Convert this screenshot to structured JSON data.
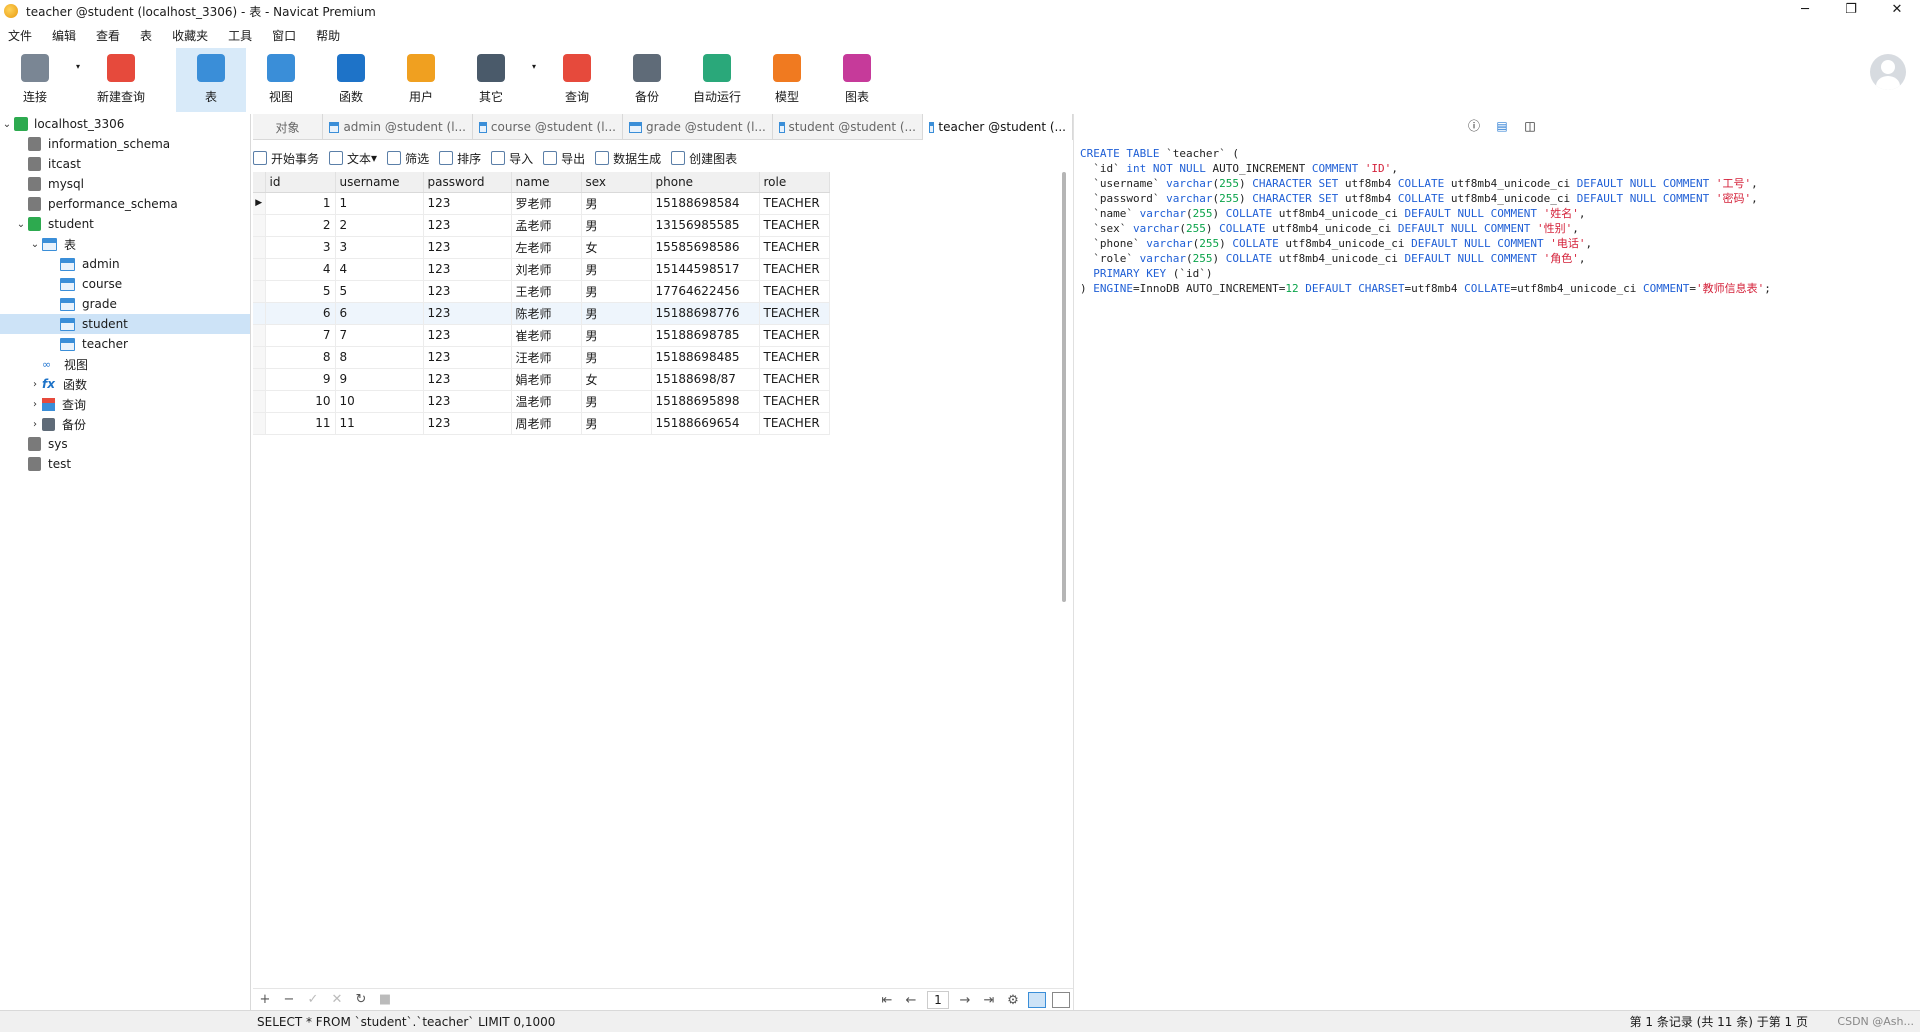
{
  "window": {
    "title": "teacher @student (localhost_3306) - 表 - Navicat Premium",
    "controls": [
      "─",
      "❐",
      "✕"
    ]
  },
  "menu": [
    "文件",
    "编辑",
    "查看",
    "表",
    "收藏夹",
    "工具",
    "窗口",
    "帮助"
  ],
  "toolbar": [
    {
      "label": "连接",
      "icon": "plug-icon",
      "color": "#7a8694",
      "caret": true
    },
    {
      "label": "新建查询",
      "icon": "new-query-icon",
      "color": "#e64a3c",
      "caret": false
    },
    {
      "label": "表",
      "icon": "table-icon",
      "color": "#3a8ed8",
      "caret": false,
      "active": true
    },
    {
      "label": "视图",
      "icon": "view-icon",
      "color": "#3a8ed8",
      "caret": false
    },
    {
      "label": "函数",
      "icon": "function-icon",
      "color": "#1e73c8",
      "caret": false
    },
    {
      "label": "用户",
      "icon": "user-icon",
      "color": "#f0a020",
      "caret": false
    },
    {
      "label": "其它",
      "icon": "tools-icon",
      "color": "#4a5a6a",
      "caret": true
    },
    {
      "label": "查询",
      "icon": "query-icon",
      "color": "#e64a3c",
      "caret": false
    },
    {
      "label": "备份",
      "icon": "backup-icon",
      "color": "#5f6b78",
      "caret": false
    },
    {
      "label": "自动运行",
      "icon": "robot-icon",
      "color": "#2aa87a",
      "caret": false
    },
    {
      "label": "模型",
      "icon": "model-icon",
      "color": "#f07a20",
      "caret": false
    },
    {
      "label": "图表",
      "icon": "chart-icon",
      "color": "#c63a9a",
      "caret": false
    }
  ],
  "tree": {
    "connection": "localhost_3306",
    "databases_top": [
      "information_schema",
      "itcast",
      "mysql",
      "performance_schema"
    ],
    "student": "student",
    "tables_label": "表",
    "tables": [
      "admin",
      "course",
      "grade",
      "student",
      "teacher"
    ],
    "views_label": "视图",
    "functions_label": "函数",
    "queries_label": "查询",
    "backups_label": "备份",
    "databases_bottom": [
      "sys",
      "test"
    ]
  },
  "tabs": [
    "对象",
    "admin @student (l...",
    "course @student (l...",
    "grade @student (l...",
    "student @student (...",
    "teacher @student (..."
  ],
  "gridbar": [
    "开始事务",
    "文本",
    "筛选",
    "排序",
    "导入",
    "导出",
    "数据生成",
    "创建图表"
  ],
  "table": {
    "columns": [
      "id",
      "username",
      "password",
      "name",
      "sex",
      "phone",
      "role"
    ],
    "rows": [
      [
        "1",
        "1",
        "123",
        "罗老师",
        "男",
        "15188698584",
        "TEACHER"
      ],
      [
        "2",
        "2",
        "123",
        "孟老师",
        "男",
        "13156985585",
        "TEACHER"
      ],
      [
        "3",
        "3",
        "123",
        "左老师",
        "女",
        "15585698586",
        "TEACHER"
      ],
      [
        "4",
        "4",
        "123",
        "刘老师",
        "男",
        "15144598517",
        "TEACHER"
      ],
      [
        "5",
        "5",
        "123",
        "王老师",
        "男",
        "17764622456",
        "TEACHER"
      ],
      [
        "6",
        "6",
        "123",
        "陈老师",
        "男",
        "15188698776",
        "TEACHER"
      ],
      [
        "7",
        "7",
        "123",
        "崔老师",
        "男",
        "15188698785",
        "TEACHER"
      ],
      [
        "8",
        "8",
        "123",
        "汪老师",
        "男",
        "15188698485",
        "TEACHER"
      ],
      [
        "9",
        "9",
        "123",
        "娟老师",
        "女",
        "15188698/87",
        "TEACHER"
      ],
      [
        "10",
        "10",
        "123",
        "温老师",
        "男",
        "15188695898",
        "TEACHER"
      ],
      [
        "11",
        "11",
        "123",
        "周老师",
        "男",
        "15188669654",
        "TEACHER"
      ]
    ]
  },
  "bottombar": {
    "buttons": [
      "+",
      "−",
      "✓",
      "✕",
      "↻",
      "■"
    ],
    "page": "1",
    "nav": [
      "⇤",
      "←",
      "→",
      "⇥",
      "⚙"
    ]
  },
  "ddl": [
    "CREATE TABLE `teacher` (",
    "  `id` int NOT NULL AUTO_INCREMENT COMMENT 'ID',",
    "  `username` varchar(255) CHARACTER SET utf8mb4 COLLATE utf8mb4_unicode_ci DEFAULT NULL COMMENT '工号',",
    "  `password` varchar(255) CHARACTER SET utf8mb4 COLLATE utf8mb4_unicode_ci DEFAULT NULL COMMENT '密码',",
    "  `name` varchar(255) COLLATE utf8mb4_unicode_ci DEFAULT NULL COMMENT '姓名',",
    "  `sex` varchar(255) COLLATE utf8mb4_unicode_ci DEFAULT NULL COMMENT '性别',",
    "  `phone` varchar(255) COLLATE utf8mb4_unicode_ci DEFAULT NULL COMMENT '电话',",
    "  `role` varchar(255) COLLATE utf8mb4_unicode_ci DEFAULT NULL COMMENT '角色',",
    "  PRIMARY KEY (`id`)",
    ") ENGINE=InnoDB AUTO_INCREMENT=12 DEFAULT CHARSET=utf8mb4 COLLATE=utf8mb4_unicode_ci COMMENT='教师信息表';"
  ],
  "status": {
    "sql": "SELECT * FROM `student`.`teacher` LIMIT 0,1000",
    "records": "第 1 条记录 (共 11 条) 于第 1 页",
    "watermark": "CSDN @Ash..."
  }
}
